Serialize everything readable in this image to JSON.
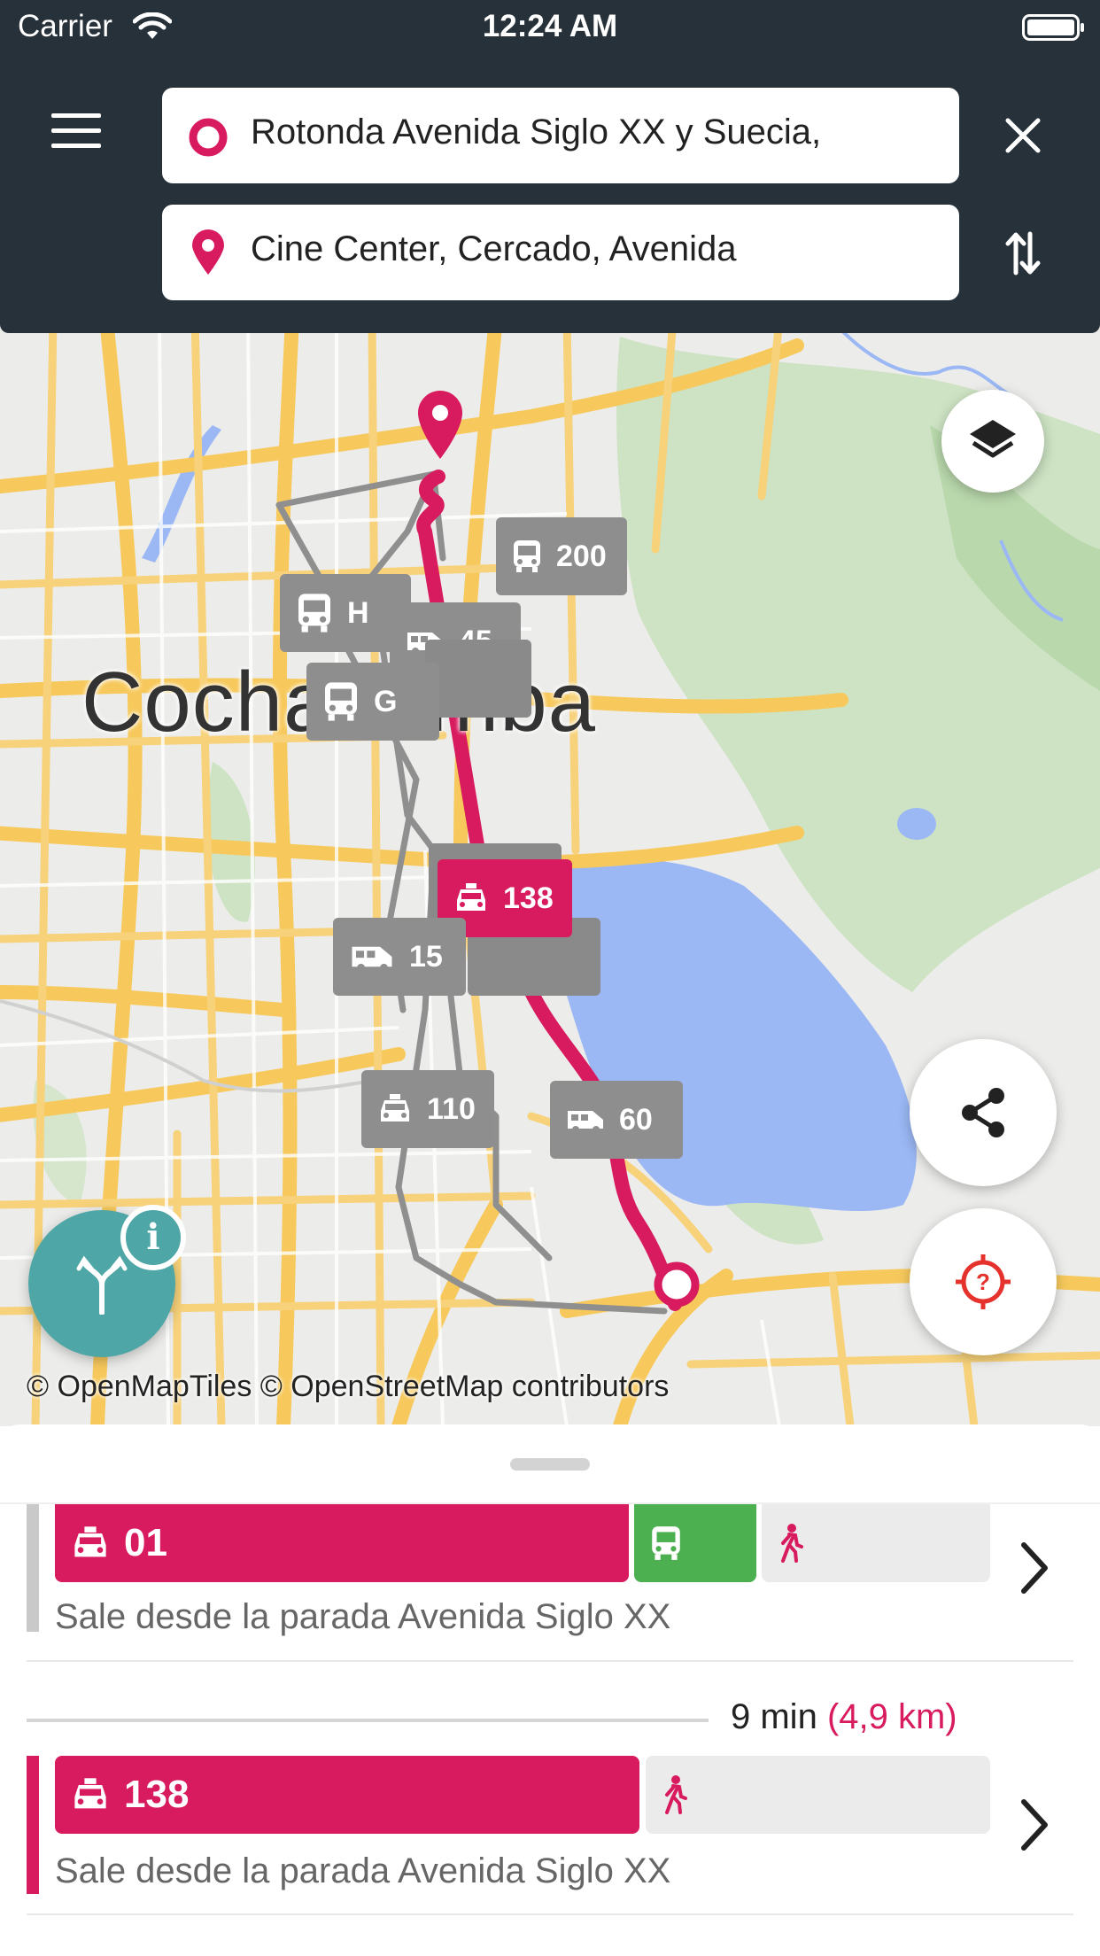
{
  "status_bar": {
    "carrier": "Carrier",
    "time": "12:24 AM"
  },
  "search": {
    "origin": "Rotonda Avenida Siglo XX y Suecia,",
    "destination": "Cine Center, Cercado, Avenida"
  },
  "map": {
    "city_label": "Cochabamba",
    "attribution": "© OpenMapTiles © OpenStreetMap contributors",
    "route_badges": [
      {
        "label": "200",
        "icon": "bus-icon",
        "active": false
      },
      {
        "label": "H",
        "icon": "bus-icon",
        "active": false
      },
      {
        "label": "45",
        "icon": "van-icon",
        "active": false
      },
      {
        "label": "G",
        "icon": "bus-icon",
        "active": false
      },
      {
        "label": "138",
        "icon": "taxi-icon",
        "active": true
      },
      {
        "label": "15",
        "icon": "van-icon",
        "active": false
      },
      {
        "label": "110",
        "icon": "taxi-icon",
        "active": false
      },
      {
        "label": "60",
        "icon": "van-icon",
        "active": false
      }
    ],
    "info_badge": "i"
  },
  "results": [
    {
      "segments": [
        {
          "type": "taxi",
          "label": "01",
          "icon": "taxi-icon"
        },
        {
          "type": "bus",
          "label": "",
          "icon": "bus-icon"
        },
        {
          "type": "walk",
          "label": "",
          "icon": "walk-icon"
        }
      ],
      "description": "Sale desde la parada Avenida Siglo XX"
    },
    {
      "duration": "9 min",
      "distance": "(4,9 km)",
      "segments": [
        {
          "type": "taxi",
          "label": "138",
          "icon": "taxi-icon"
        },
        {
          "type": "walk",
          "label": "",
          "icon": "walk-icon"
        }
      ],
      "description": "Sale desde la parada Avenida Siglo XX"
    }
  ],
  "colors": {
    "header": "#27313a",
    "accent": "#d81b5e",
    "bus_green": "#4caf50",
    "fab_teal": "#4ea7a6",
    "badge_gray": "#8e8e8e",
    "water": "#9bb8f5",
    "park": "#cde3c3",
    "road": "#f7c95c"
  }
}
